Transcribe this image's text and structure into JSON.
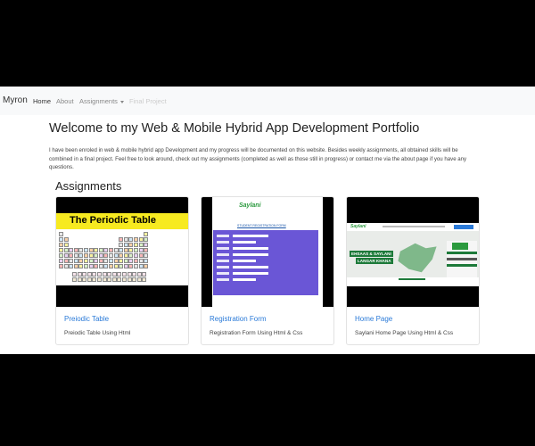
{
  "navbar": {
    "brand": "Myron",
    "links": [
      {
        "label": "Home",
        "state": "active"
      },
      {
        "label": "About",
        "state": "normal"
      },
      {
        "label": "Assignments",
        "state": "dropdown"
      },
      {
        "label": "Final Project",
        "state": "disabled"
      }
    ]
  },
  "main": {
    "title": "Welcome to my Web & Mobile Hybrid App Development Portfolio",
    "intro": "I have been enroled in web & mobile hybrid app Development and my progress will be documented on this website. Besides weekly assignments, all obtained skills will be combined in a final project. Feel free to look around, check out my assignments (completed as well as those still in progress) or contact me via the about page if you have any questions.",
    "section_title": "Assignments"
  },
  "cards": [
    {
      "title": "Preiodic Table",
      "text": "Preiodic Table Using Html",
      "thumbnail": {
        "heading": "The Periodic Table"
      }
    },
    {
      "title": "Registration Form",
      "text": "Registration Form Using Html & Css",
      "thumbnail": {
        "logo": "Saylani",
        "heading": "STUDENT REGISTRATION FORM"
      }
    },
    {
      "title": "Home Page",
      "text": "Saylani Home Page Using Html & Css",
      "thumbnail": {
        "logo": "Saylani",
        "banner_line1": "EHSAAS & SAYLANI",
        "banner_line2": "LANGAR KHANA"
      }
    }
  ],
  "colors": {
    "page_bg": "#000000",
    "navbar_bg": "#f8f9fa",
    "link": "#2a7ad8",
    "periodic_band": "#f7ea20",
    "form_purple": "#6a56d6",
    "saylani_green": "#2b9a3e"
  }
}
